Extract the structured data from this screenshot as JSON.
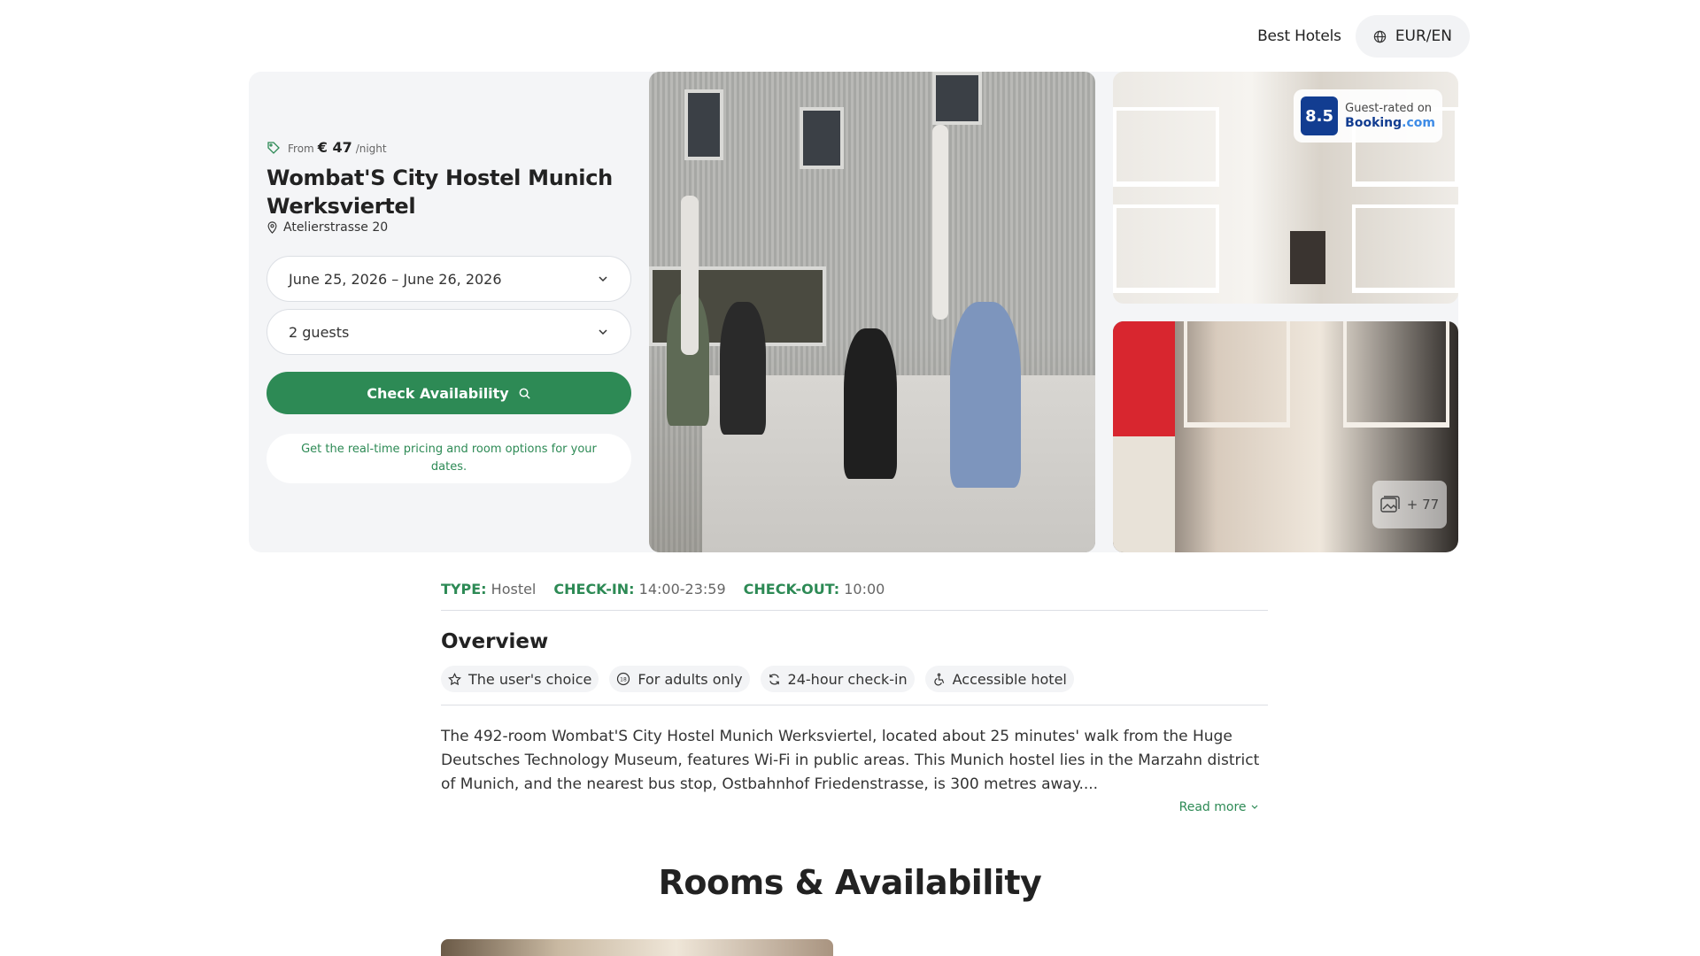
{
  "header": {
    "nav_link": "Best Hotels",
    "currency_lang": "EUR/EN"
  },
  "hotel": {
    "price_prefix": "From",
    "price": "€ 47",
    "price_unit": "/night",
    "name": "Wombat'S City Hostel Munich Werksviertel",
    "address": "Atelierstrasse 20"
  },
  "booking": {
    "dates": "June 25, 2026 – June 26, 2026",
    "guests": "2 guests",
    "check_button": "Check Availability",
    "hint": "Get the real-time pricing and room options for your dates."
  },
  "rating": {
    "score": "8.5",
    "label": "Guest-rated on",
    "brand": "Booking",
    "brand_suffix": ".com"
  },
  "gallery": {
    "more_count": "+ 77"
  },
  "facts": {
    "type_label": "TYPE:",
    "type_value": "Hostel",
    "checkin_label": "CHECK-IN:",
    "checkin_value": "14:00-23:59",
    "checkout_label": "CHECK-OUT:",
    "checkout_value": "10:00"
  },
  "overview": {
    "title": "Overview",
    "chips": [
      "The user's choice",
      "For adults only",
      "24-hour check-in",
      "Accessible hotel"
    ],
    "description": "The 492-room Wombat'S City Hostel Munich Werksviertel, located about 25 minutes' walk from the Huge Deutsches Technology Museum, features Wi-Fi in public areas. This Munich hostel lies in the Marzahn district of Munich, and the nearest bus stop, Ostbahnhof Friedenstrasse, is 300 metres away....",
    "read_more": "Read more"
  },
  "rooms": {
    "title": "Rooms & Availability"
  },
  "colors": {
    "accent": "#2d8a55",
    "booking_blue": "#123d91"
  }
}
